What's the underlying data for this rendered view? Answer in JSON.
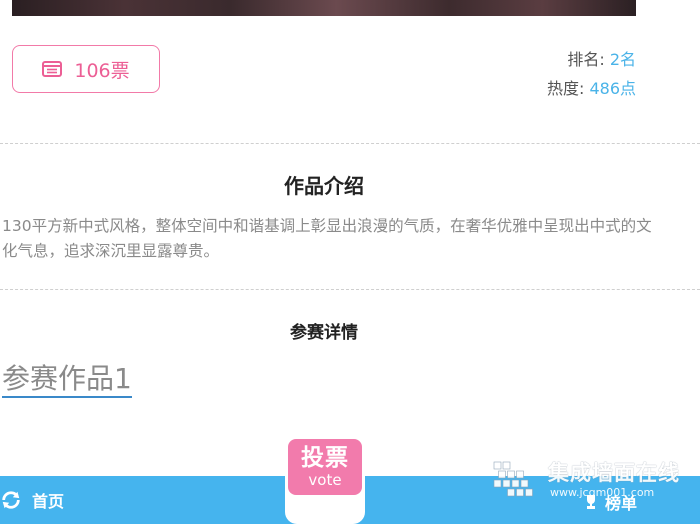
{
  "vote_box": {
    "count": "106票",
    "icon": "list-icon"
  },
  "stats": {
    "rank_label": "排名:",
    "rank_value": "2名",
    "heat_label": "热度:",
    "heat_value": "486点"
  },
  "intro": {
    "title": "作品介绍",
    "text": "130平方新中式风格，整体空间中和谐基调上彰显出浪漫的气质，在奢华优雅中呈现出中式的文化气息，追求深沉里显露尊贵。"
  },
  "details": {
    "title": "参赛详情",
    "work_link": "参赛作品1"
  },
  "bottom_nav": {
    "home_label": "首页",
    "home_icon": "refresh-icon",
    "vote_main": "投票",
    "vote_sub": "vote",
    "rank_label": "榜单",
    "rank_icon": "trophy-icon"
  },
  "watermark": {
    "name": "集成墙面在线",
    "url": "www.jcqm001.com"
  },
  "colors": {
    "accent_pink": "#f27bac",
    "accent_blue": "#45b4ee",
    "value_blue": "#4ab3e8"
  }
}
